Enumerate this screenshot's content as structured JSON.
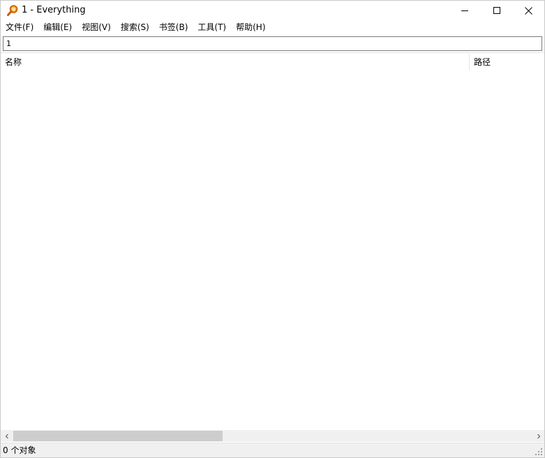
{
  "window": {
    "title": "1 - Everything",
    "app_icon": "magnifier-icon",
    "accent_icon_color": "#e07a10"
  },
  "menubar": {
    "items": [
      {
        "label": "文件(F)"
      },
      {
        "label": "编辑(E)"
      },
      {
        "label": "视图(V)"
      },
      {
        "label": "搜索(S)"
      },
      {
        "label": "书签(B)"
      },
      {
        "label": "工具(T)"
      },
      {
        "label": "帮助(H)"
      }
    ]
  },
  "search": {
    "value": "1",
    "placeholder": ""
  },
  "columns": {
    "name": "名称",
    "path": "路径"
  },
  "results": [],
  "statusbar": {
    "text": "0 个对象"
  }
}
